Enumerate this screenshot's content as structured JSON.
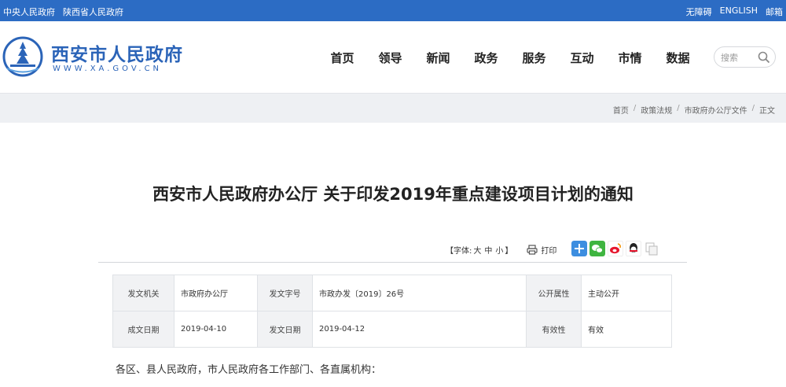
{
  "topbar": {
    "links_left": [
      "中央人民政府",
      "陕西省人民政府"
    ],
    "links_right": [
      "无障碍",
      "ENGLISH",
      "邮箱"
    ]
  },
  "logo": {
    "title": "西安市人民政府",
    "url": "WWW.XA.GOV.CN"
  },
  "nav": [
    "首页",
    "领导",
    "新闻",
    "政务",
    "服务",
    "互动",
    "市情",
    "数据"
  ],
  "search": {
    "placeholder": "搜索"
  },
  "breadcrumb": [
    "首页",
    "政策法规",
    "市政府办公厅文件",
    "正文"
  ],
  "document": {
    "title": "西安市人民政府办公厅 关于印发2019年重点建设项目计划的通知",
    "font_size": {
      "label": "【字体:",
      "large": "大",
      "medium": "中",
      "small": "小",
      "end": "】"
    },
    "print_label": "打印",
    "meta": [
      [
        {
          "key": "发文机关",
          "value": "市政府办公厅"
        },
        {
          "key": "发文字号",
          "value": "市政办发〔2019〕26号"
        },
        {
          "key": "公开属性",
          "value": "主动公开"
        }
      ],
      [
        {
          "key": "成文日期",
          "value": "2019-04-10"
        },
        {
          "key": "发文日期",
          "value": "2019-04-12"
        },
        {
          "key": "有效性",
          "value": "有效"
        }
      ]
    ],
    "greeting": "各区、县人民政府，市人民政府各工作部门、各直属机构："
  },
  "colors": {
    "brand": "#2c6cc4",
    "logo_text": "#2b64b8"
  },
  "icons": [
    "search-icon",
    "print-icon",
    "share-plus-icon",
    "wechat-icon",
    "weibo-icon",
    "qq-icon",
    "copy-icon"
  ]
}
